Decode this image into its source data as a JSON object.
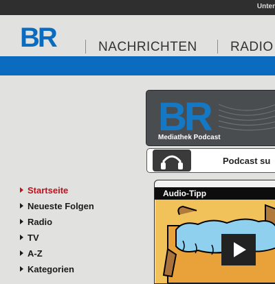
{
  "topbar": {
    "text": "Unter"
  },
  "header": {
    "logo": "BR",
    "nav": [
      {
        "label": "NACHRICHTEN"
      },
      {
        "label": "RADIO"
      }
    ]
  },
  "banner": {
    "logo": "BR",
    "caption": "Mediathek Podcast"
  },
  "podcast": {
    "label": "Podcast su",
    "icon": "headphones-icon"
  },
  "sidenav": {
    "items": [
      {
        "label": "Startseite",
        "active": true
      },
      {
        "label": "Neueste Folgen"
      },
      {
        "label": "Radio"
      },
      {
        "label": "TV"
      },
      {
        "label": "A-Z"
      },
      {
        "label": "Kategorien"
      }
    ]
  },
  "audio_tipp": {
    "title": "Audio-Tipp"
  },
  "colors": {
    "brand_blue": "#0a6bbf",
    "active_link": "#c0101a",
    "topbar": "#2f2f2f"
  }
}
